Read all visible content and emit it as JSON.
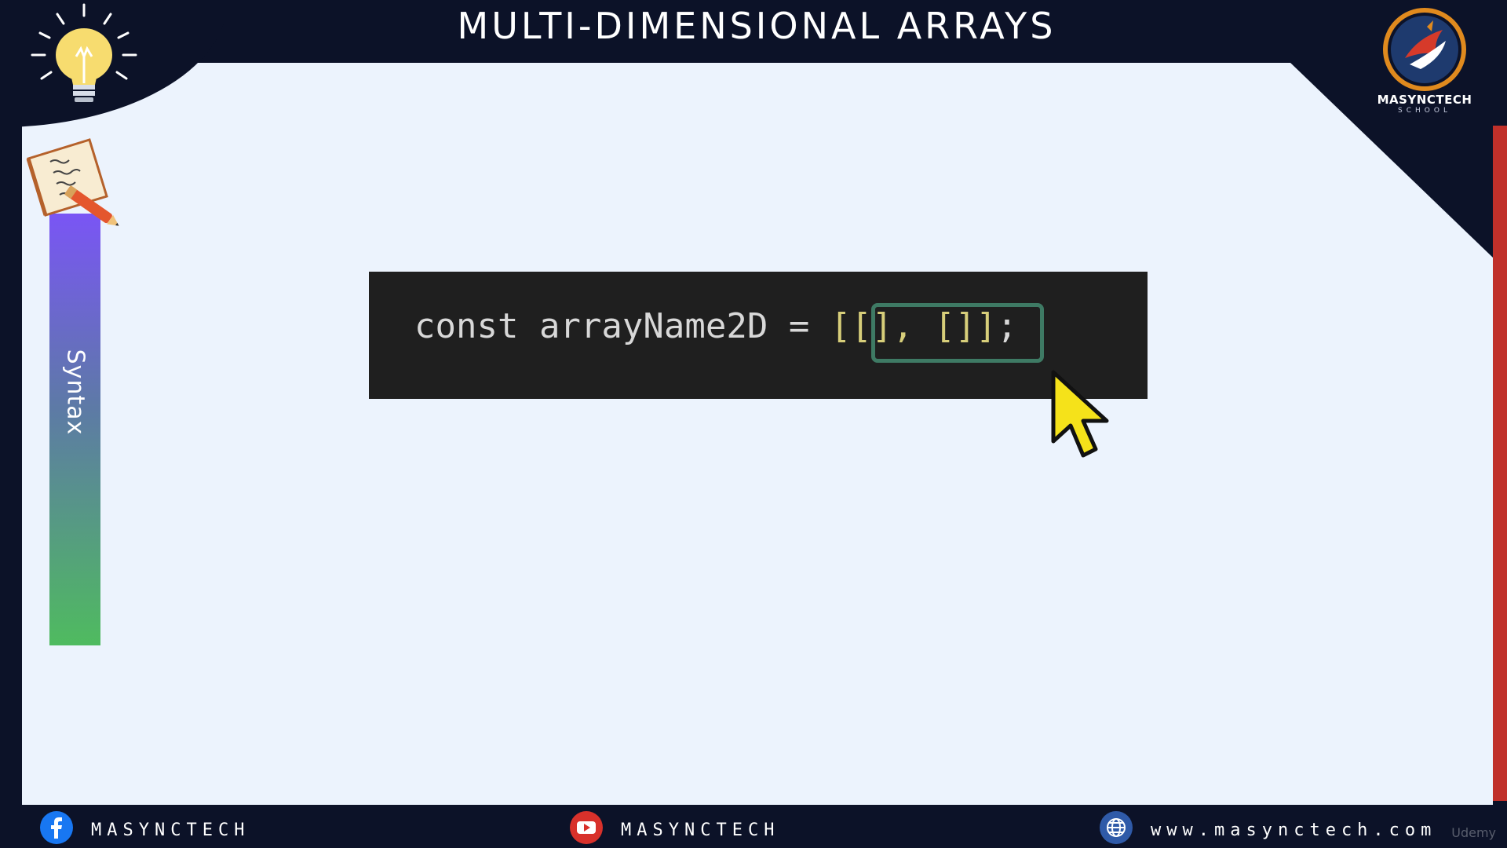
{
  "slide": {
    "title": "MULTI-DIMENSIONAL ARRAYS",
    "side_tab_label": "Syntax"
  },
  "code": {
    "prefix": "const arrayName2D = ",
    "array_literal": "[[], []]",
    "suffix": ";"
  },
  "logo": {
    "name": "MASYNCTECH",
    "sub": "SCHOOL"
  },
  "footer": {
    "facebook_label": "MASYNCTECH",
    "youtube_label": "MASYNCTECH",
    "website_label": "www.masynctech.com"
  },
  "watermark": "Udemy",
  "colors": {
    "background_dark": "#0c1228",
    "slide_bg": "#ecf3fd",
    "code_bg": "#1f1f1f",
    "highlight_border": "#3e7a64",
    "accent_red": "#c0302a",
    "cursor_yellow": "#f5e21a"
  },
  "icons": {
    "bulb": "lightbulb-icon",
    "notebook": "notebook-pencil-icon",
    "cursor": "mouse-pointer-icon",
    "facebook": "facebook-icon",
    "youtube": "youtube-icon",
    "website": "globe-icon",
    "logo": "masynctech-logo-icon"
  }
}
